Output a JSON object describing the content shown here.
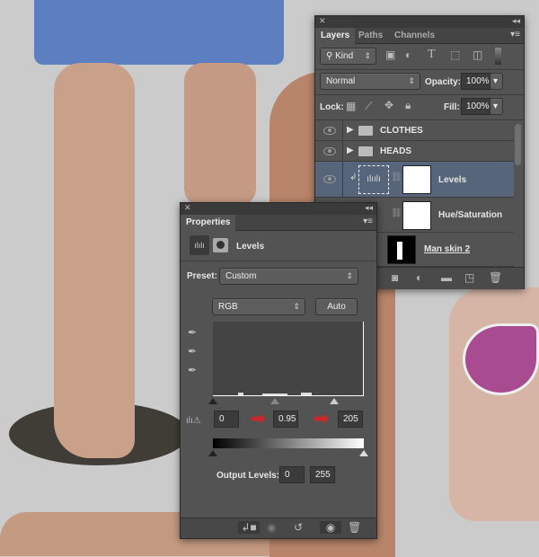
{
  "layers_panel": {
    "tabs": [
      "Layers",
      "Paths",
      "Channels"
    ],
    "filter_kind": "Kind",
    "blend_mode": "Normal",
    "opacity_label": "Opacity:",
    "opacity": "100%",
    "lock_label": "Lock:",
    "fill_label": "Fill:",
    "fill": "100%",
    "layers": [
      {
        "name": "CLOTHES",
        "type": "group"
      },
      {
        "name": "HEADS",
        "type": "group"
      },
      {
        "name": "Levels",
        "type": "adjustment",
        "selected": true
      },
      {
        "name": "Hue/Saturation",
        "type": "adjustment"
      },
      {
        "name": "Man skin 2",
        "type": "layer"
      }
    ]
  },
  "properties_panel": {
    "tab": "Properties",
    "adjustment_title": "Levels",
    "preset_label": "Preset:",
    "preset_value": "Custom",
    "channel": "RGB",
    "auto_label": "Auto",
    "input_black": "0",
    "input_gamma": "0.95",
    "input_white": "205",
    "output_label": "Output Levels:",
    "output_black": "0",
    "output_white": "255"
  },
  "colors": {
    "panel": "#535353",
    "selected_row": "#56657a",
    "arrow": "#c8282a"
  }
}
